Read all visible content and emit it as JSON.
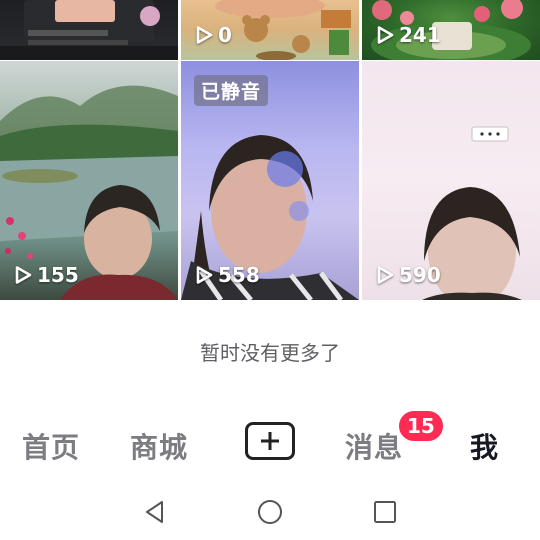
{
  "feed": {
    "tiles": [
      {
        "count": ""
      },
      {
        "count": "0"
      },
      {
        "count": "241"
      },
      {
        "count": "155"
      },
      {
        "count": "558",
        "badge": "已静音"
      },
      {
        "count": "590"
      }
    ]
  },
  "end_of_list": "暂时没有更多了",
  "tabbar": {
    "home": "首页",
    "mall": "商城",
    "add": "create-post",
    "messages": "消息",
    "messages_badge": "15",
    "me": "我",
    "active": "我"
  },
  "system_nav": {
    "back": "back-triangle-icon",
    "home": "home-circle-icon",
    "recents": "recents-square-icon"
  },
  "colors": {
    "accent": "#fe2c55",
    "text_active": "#161823",
    "text_inactive": "#7c7c82"
  }
}
